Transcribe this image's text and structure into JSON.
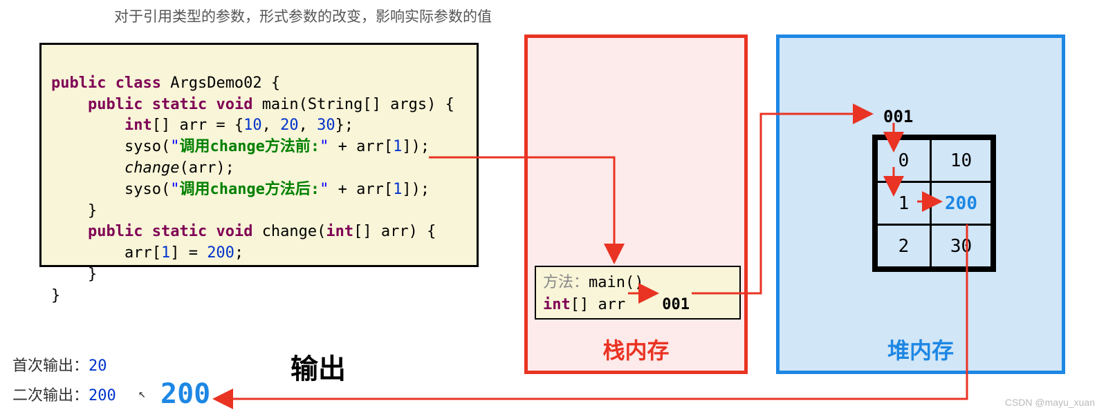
{
  "title": "对于引用类型的参数，形式参数的改变，影响实际参数的值",
  "code": {
    "line1_public": "public",
    "line1_class": "class",
    "line1_name": "ArgsDemo02 {",
    "line2_public": "public",
    "line2_static": "static",
    "line2_void": "void",
    "line2_rest": "main(String[] args) {",
    "line3_int": "int",
    "line3_arr": "[] arr = {",
    "line3_n1": "10",
    "line3_c1": ", ",
    "line3_n2": "20",
    "line3_c2": ", ",
    "line3_n3": "30",
    "line3_end": "};",
    "line4_syso": "syso(",
    "line4_q1": "\"",
    "line4_str": "调用change方法前:",
    "line4_q2": "\"",
    "line4_plus": " + arr[",
    "line4_idx": "1",
    "line4_end": "]);",
    "line5_change": "change",
    "line5_rest": "(arr);",
    "line6_syso": "syso(",
    "line6_q1": "\"",
    "line6_str": "调用change方法后:",
    "line6_q2": "\"",
    "line6_plus": " + arr[",
    "line6_idx": "1",
    "line6_end": "]);",
    "line7": "}",
    "line8_public": "public",
    "line8_static": "static",
    "line8_void": "void",
    "line8_change": "change(",
    "line8_int": "int",
    "line8_rest": "[] arr) {",
    "line9_a": "arr[",
    "line9_i": "1",
    "line9_b": "] = ",
    "line9_v": "200",
    "line9_c": ";",
    "line10": "}",
    "line11": "}"
  },
  "stack": {
    "label": "栈内存",
    "frame_prefix": "方法：",
    "frame_method": "main()",
    "frame_decl_type": "int",
    "frame_decl_rest": "[] arr",
    "frame_addr": "001"
  },
  "heap": {
    "label": "堆内存",
    "addr": "001",
    "rows": [
      {
        "idx": "0",
        "val": "10"
      },
      {
        "idx": "1",
        "val": "200"
      },
      {
        "idx": "2",
        "val": "30"
      }
    ]
  },
  "output": {
    "label": "输出",
    "first_prefix": "首次输出：",
    "first_val": "20",
    "second_prefix": "二次输出：",
    "second_val": "200",
    "big_val": "200"
  },
  "watermark": "CSDN @mayu_xuan"
}
